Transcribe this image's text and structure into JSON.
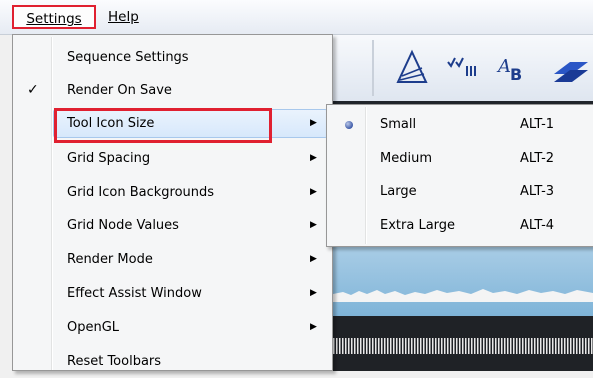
{
  "menubar": {
    "settings": "Settings",
    "help": "Help"
  },
  "settings_menu": {
    "items": [
      {
        "label": "Sequence Settings"
      },
      {
        "label": "Render On Save",
        "checked": true
      },
      {
        "label": "Tool Icon Size",
        "submenu": true
      },
      {
        "label": "Grid Spacing",
        "submenu": true
      },
      {
        "label": "Grid Icon Backgrounds",
        "submenu": true
      },
      {
        "label": "Grid Node Values",
        "submenu": true
      },
      {
        "label": "Render Mode",
        "submenu": true
      },
      {
        "label": "Effect Assist Window",
        "submenu": true
      },
      {
        "label": "OpenGL",
        "submenu": true
      },
      {
        "label": "Reset Toolbars"
      }
    ],
    "check_glyph": "✓",
    "arrow_glyph": "▶"
  },
  "tool_icon_size_submenu": {
    "items": [
      {
        "label": "Small",
        "shortcut": "ALT-1",
        "selected": true
      },
      {
        "label": "Medium",
        "shortcut": "ALT-2"
      },
      {
        "label": "Large",
        "shortcut": "ALT-3"
      },
      {
        "label": "Extra Large",
        "shortcut": "ALT-4"
      }
    ]
  },
  "toolbar_icons": [
    "triangle-outline-icon",
    "tally-bars-icon",
    "text-ab-icon",
    "layers-icon"
  ],
  "colors": {
    "callout": "#e02030",
    "highlight": "#d7e8fb",
    "menu_bg": "#f5f6f7"
  }
}
